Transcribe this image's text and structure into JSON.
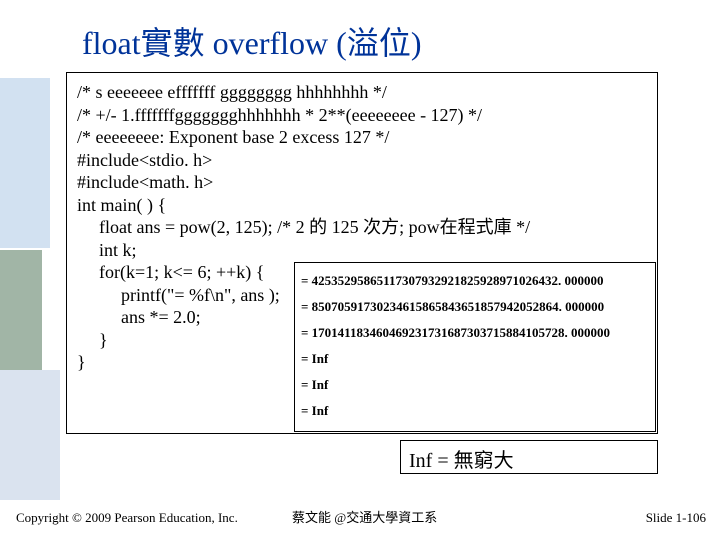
{
  "title": "float實數 overflow (溢位)",
  "code": {
    "l1": "/* s eeeeeee efffffff gggggggg hhhhhhhh */",
    "l2": "/* +/- 1.fffffffggggggghhhhhhh * 2**(eeeeeeee - 127) */",
    "l3": "/*  eeeeeeee: Exponent base 2 excess 127 */",
    "l4": "#include<stdio. h>",
    "l5": "#include<math. h>",
    "l6": "int main( ) {",
    "l7": "float ans = pow(2, 125);   /* 2 的 125 次方; pow在程式庫 */",
    "l8": "int k;",
    "l9": "for(k=1; k<= 6; ++k) {",
    "l10": "printf(\"= %f\\n\", ans );",
    "l11": "ans *= 2.0;",
    "l12": "}",
    "l13": "}"
  },
  "output": {
    "o1": "= 42535295865117307932921825928971026432. 000000",
    "o2": "= 85070591730234615865843651857942052864. 000000",
    "o3": "= 170141183460469231731687303715884105728. 000000",
    "o4": "= Inf",
    "o5": "= Inf",
    "o6": "= Inf"
  },
  "inf_note": "Inf = 無窮大",
  "footer": {
    "copyright": "Copyright © 2009 Pearson Education, Inc.",
    "center": "蔡文能 @交通大學資工系",
    "slide": "Slide 1-106"
  }
}
